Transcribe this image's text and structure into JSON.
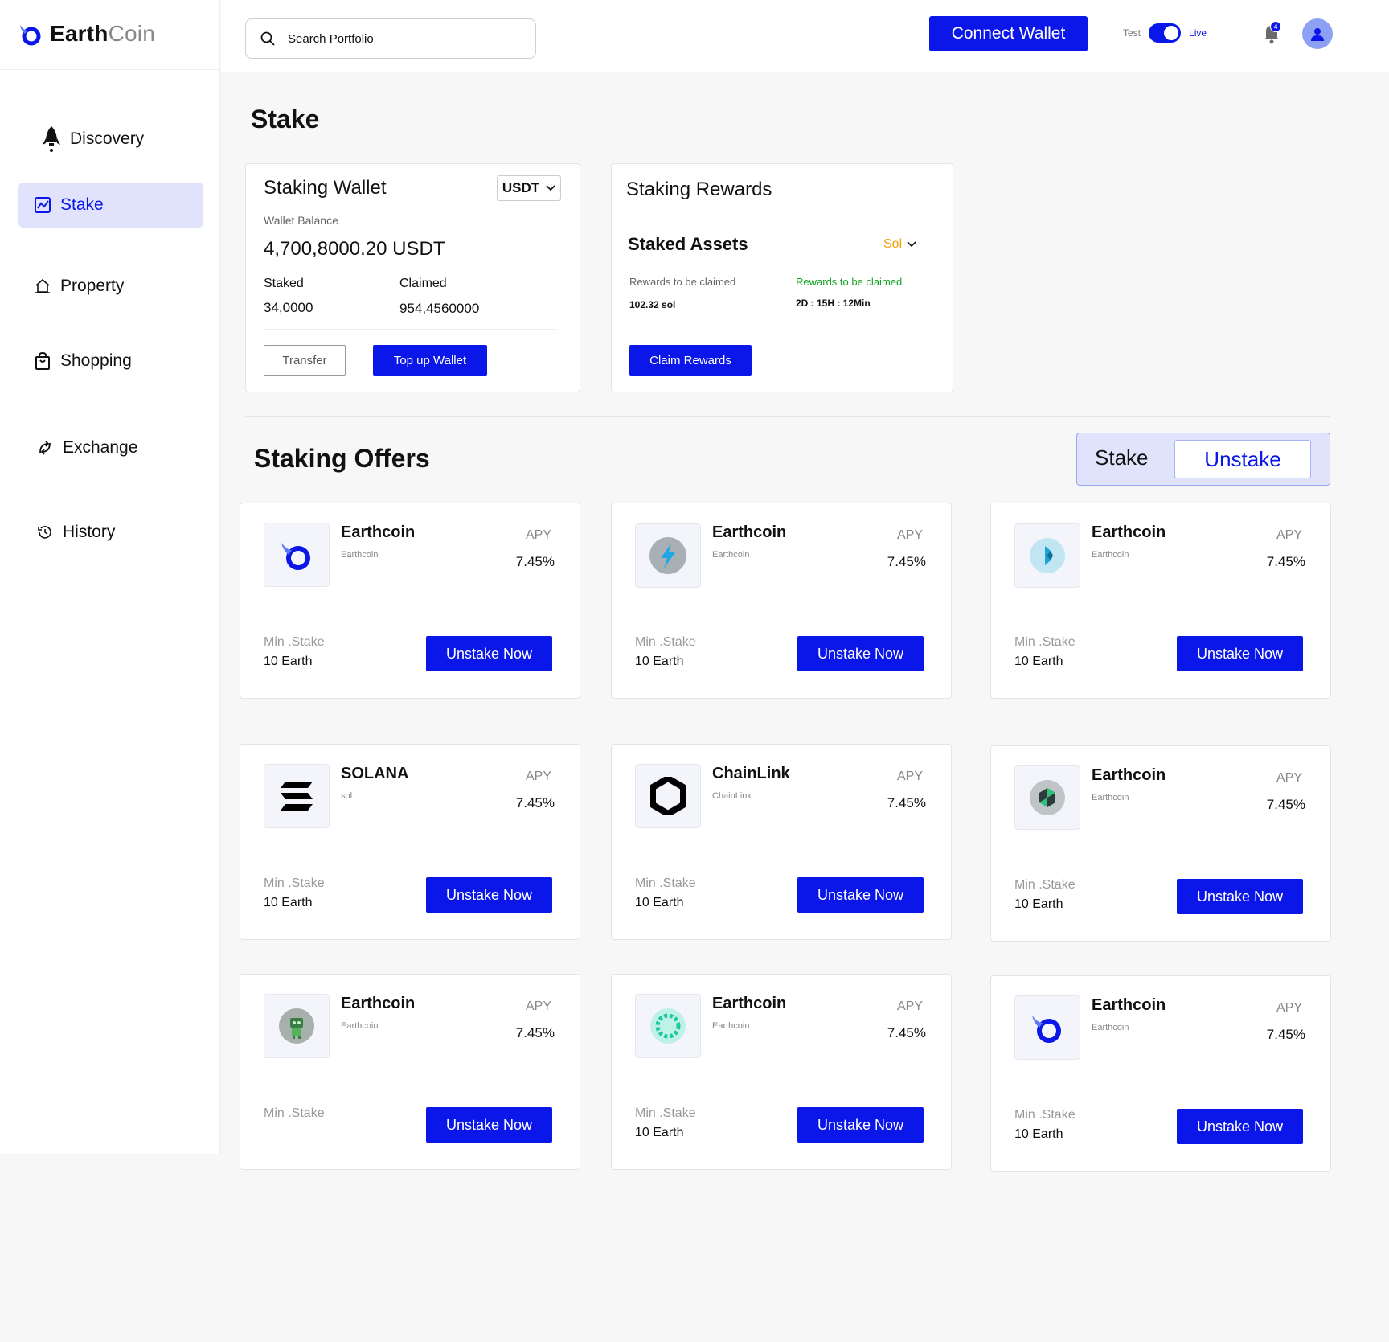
{
  "app": {
    "brand_part1": "Earth",
    "brand_part2": "Coin"
  },
  "header": {
    "search_placeholder": "Search Portfolio",
    "connect_label": "Connect Wallet",
    "toggle_left": "Test",
    "toggle_right": "Live",
    "toggle_on": true,
    "notification_count": "4"
  },
  "sidebar": {
    "items": [
      {
        "label": "Discovery",
        "icon": "rocket-icon"
      },
      {
        "label": "Stake",
        "icon": "chart-icon",
        "active": true
      },
      {
        "label": "Property",
        "icon": "house-icon"
      },
      {
        "label": "Shopping",
        "icon": "bag-icon"
      },
      {
        "label": "Exchange",
        "icon": "exchange-icon"
      },
      {
        "label": "History",
        "icon": "history-icon"
      }
    ]
  },
  "page": {
    "title": "Stake"
  },
  "wallet": {
    "title": "Staking Wallet",
    "currency": "USDT",
    "balance_label": "Wallet Balance",
    "balance": "4,700,8000.20 USDT",
    "staked_label": "Staked",
    "staked_value": "34,0000",
    "claimed_label": "Claimed",
    "claimed_value": "954,4560000",
    "transfer_label": "Transfer",
    "topup_label": "Top up Wallet"
  },
  "rewards": {
    "title": "Staking Rewards",
    "assets_title": "Staked Assets",
    "asset_select": "Sol",
    "claim_label": "Rewards to be claimed",
    "claim_value": "102.32 sol",
    "timer_label": "Rewards to be claimed",
    "timer_value": "2D : 15H  : 12Min",
    "claim_button": "Claim Rewards"
  },
  "offers_section": {
    "title": "Staking Offers",
    "seg_stake": "Stake",
    "seg_unstake": "Unstake",
    "apy_label": "APY",
    "min_label": "Min .Stake",
    "button_label": "Unstake Now"
  },
  "offers": [
    {
      "name": "Earthcoin",
      "symbol": "Earthcoin",
      "apy": "7.45%",
      "min": "10 Earth",
      "icon": "earthcoin-logo-icon"
    },
    {
      "name": "Earthcoin",
      "symbol": "Earthcoin",
      "apy": "7.45%",
      "min": "10 Earth",
      "icon": "bolt-coin-icon"
    },
    {
      "name": "Earthcoin",
      "symbol": "Earthcoin",
      "apy": "7.45%",
      "min": "10 Earth",
      "icon": "crystal-coin-icon"
    },
    {
      "name": "SOLANA",
      "symbol": "sol",
      "apy": "7.45%",
      "min": "10 Earth",
      "icon": "solana-icon"
    },
    {
      "name": "ChainLink",
      "symbol": "ChainLink",
      "apy": "7.45%",
      "min": "10 Earth",
      "icon": "chainlink-icon"
    },
    {
      "name": "Earthcoin",
      "symbol": "Earthcoin",
      "apy": "7.45%",
      "min": "10 Earth",
      "icon": "hex-coin-icon"
    },
    {
      "name": "Earthcoin",
      "symbol": "Earthcoin",
      "apy": "7.45%",
      "min": "",
      "icon": "robot-coin-icon"
    },
    {
      "name": "Earthcoin",
      "symbol": "Earthcoin",
      "apy": "7.45%",
      "min": "10 Earth",
      "icon": "ring-coin-icon"
    },
    {
      "name": "Earthcoin",
      "symbol": "Earthcoin",
      "apy": "7.45%",
      "min": "10 Earth",
      "icon": "earthcoin-logo-icon"
    }
  ]
}
